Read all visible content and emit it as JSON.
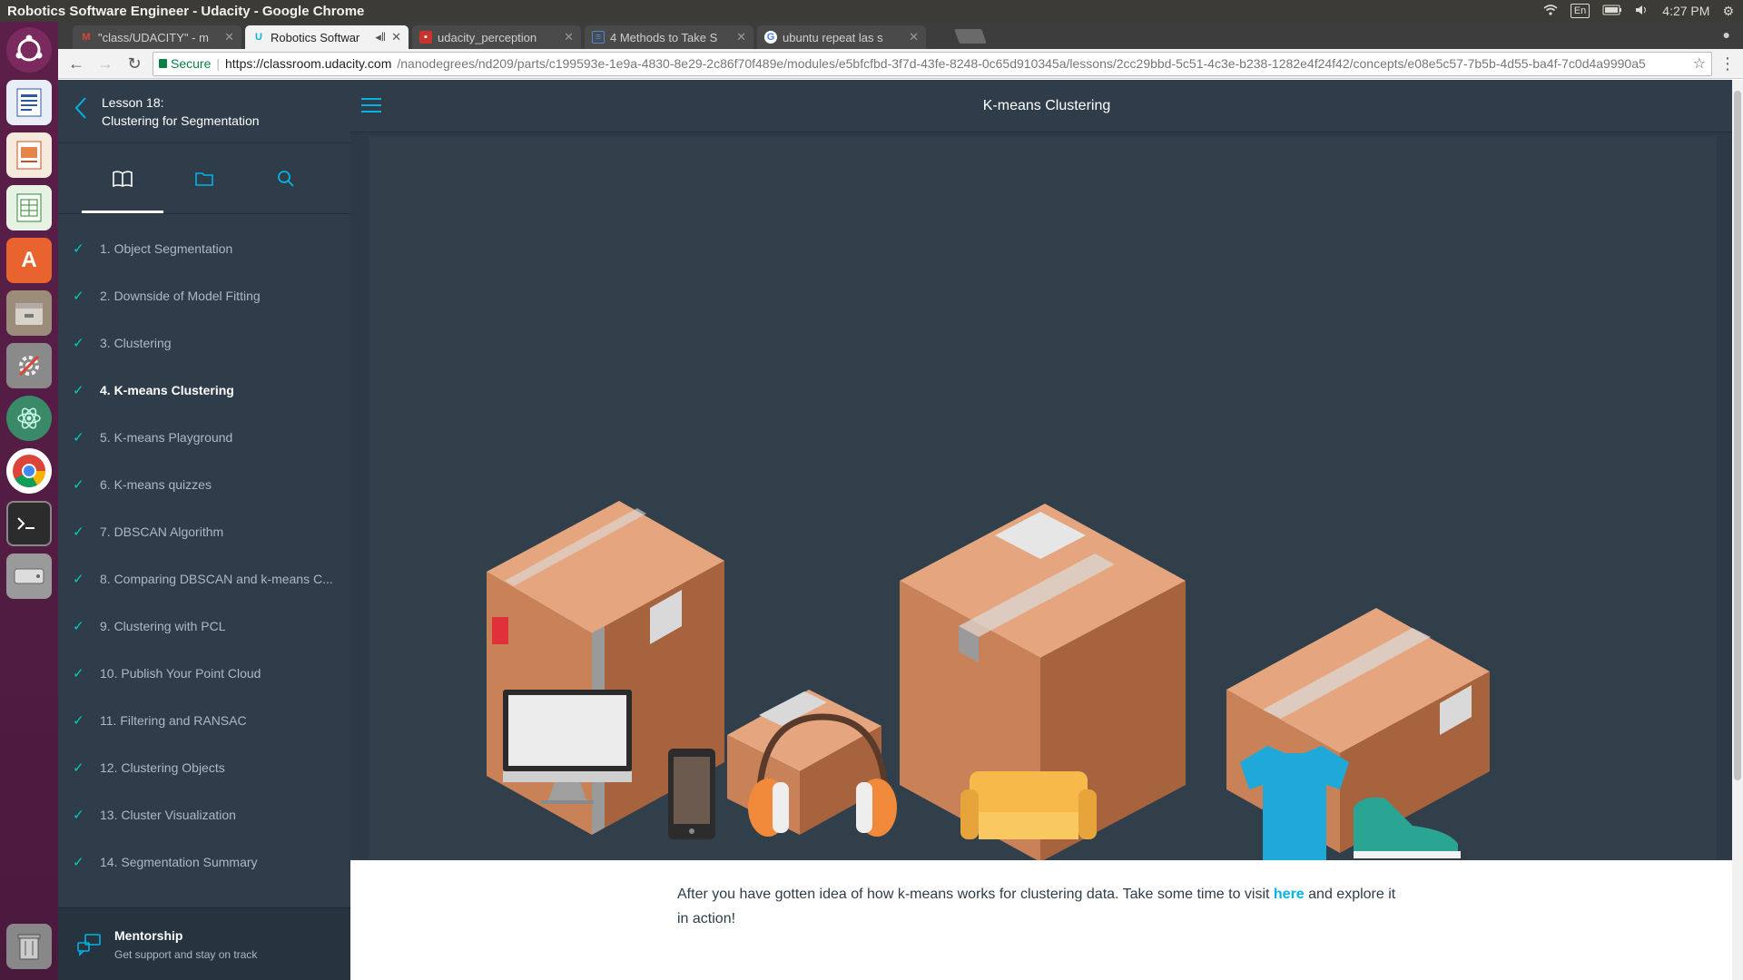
{
  "os": {
    "window_title": "Robotics Software Engineer - Udacity - Google Chrome",
    "keyboard_layout": "En",
    "clock": "4:27 PM"
  },
  "launcher": {
    "items": [
      "ubuntu-logo-icon",
      "writer-icon",
      "impress-icon",
      "calc-icon",
      "software-center-icon",
      "files-icon",
      "settings-icon",
      "atom-icon",
      "chrome-icon",
      "terminal-icon",
      "drive-icon",
      "trash-icon"
    ]
  },
  "browser": {
    "tabs": [
      {
        "title": "\"class/UDACITY\" - m",
        "favicon": "gmail-icon"
      },
      {
        "title": "Robotics Softwar",
        "favicon": "udacity-icon"
      },
      {
        "title": "udacity_perception",
        "favicon": "github-icon"
      },
      {
        "title": "4 Methods to Take S",
        "favicon": "doc-icon"
      },
      {
        "title": "ubuntu repeat las s",
        "favicon": "google-icon"
      }
    ],
    "secure_label": "Secure",
    "url_host": "https://classroom.udacity.com",
    "url_path": "/nanodegrees/nd209/parts/c199593e-1e9a-4830-8e29-2c86f70f489e/modules/e5bfcfbd-3f7d-43fe-8248-0c65d910345a/lessons/2cc29bbd-5c51-4c3e-b238-1282e4f24f42/concepts/e08e5c57-7b5b-4d55-ba4f-7c0d4a9990a5"
  },
  "sidebar": {
    "lesson_number": "Lesson 18:",
    "lesson_title": "Clustering for Segmentation",
    "concepts": [
      "1. Object Segmentation",
      "2. Downside of Model Fitting",
      "3. Clustering",
      "4. K-means Clustering",
      "5. K-means Playground",
      "6. K-means quizzes",
      "7. DBSCAN Algorithm",
      "8. Comparing DBSCAN and k-means C...",
      "9. Clustering with PCL",
      "10. Publish Your Point Cloud",
      "11. Filtering and RANSAC",
      "12. Clustering Objects",
      "13. Cluster Visualization",
      "14. Segmentation Summary"
    ],
    "mentorship_title": "Mentorship",
    "mentorship_subtitle": "Get support and stay on track"
  },
  "main": {
    "concept_title": "K-means Clustering",
    "paragraph_before_link": "After you have gotten idea of how k-means works for clustering data. Take some time to visit ",
    "link_text": "here",
    "paragraph_after_link": " and explore it in action!"
  },
  "colors": {
    "accent": "#02b3e4",
    "check": "#02ccba",
    "sidebar_bg": "#2e3d49"
  }
}
